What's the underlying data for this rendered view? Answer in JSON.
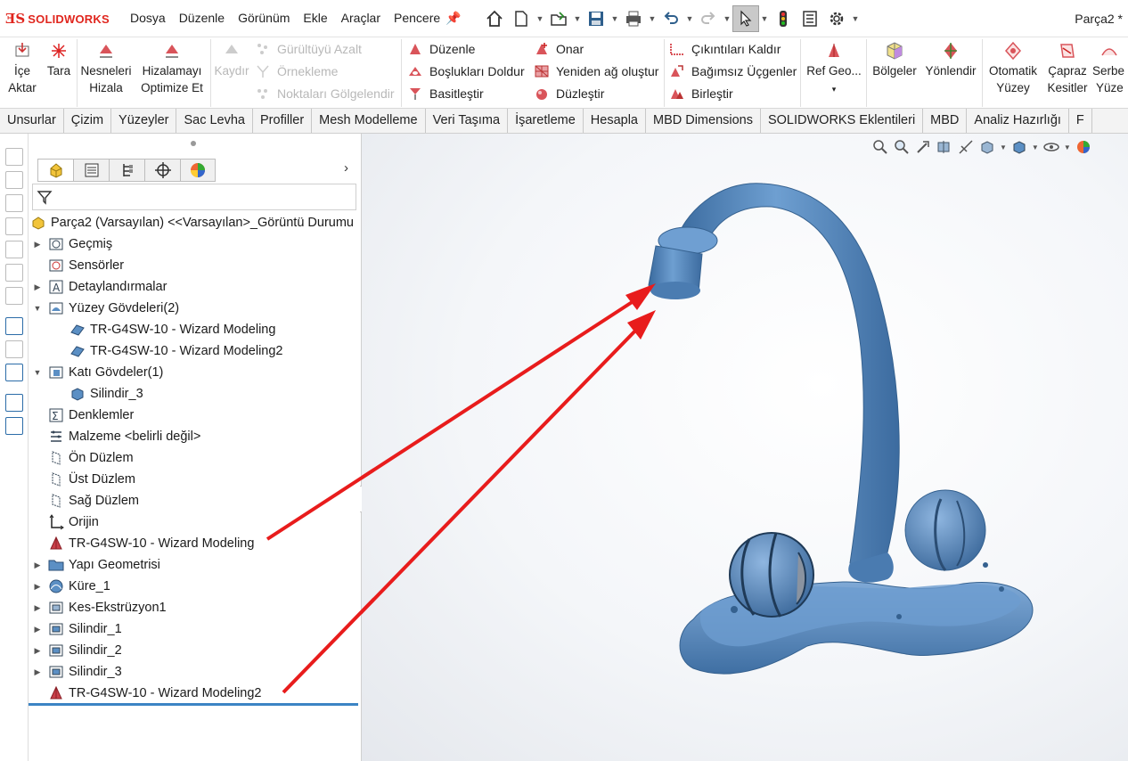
{
  "app": {
    "logo_text": "SOLIDWORKS",
    "doc_title": "Parça2 *"
  },
  "menu": [
    "Dosya",
    "Düzenle",
    "Görünüm",
    "Ekle",
    "Araçlar",
    "Pencere"
  ],
  "quick_access": [
    "home-icon",
    "new-document-icon",
    "open-icon",
    "save-icon",
    "print-icon",
    "undo-icon",
    "redo-icon",
    "select-icon",
    "rebuild-icon",
    "file-properties-icon",
    "options-icon"
  ],
  "ribbon": {
    "import": {
      "line1": "İçe",
      "line2": "Aktar"
    },
    "scan": {
      "line1": "Tara"
    },
    "align_objects": {
      "line1": "Nesneleri",
      "line2": "Hizala"
    },
    "optimize_align": {
      "line1": "Hizalamayı",
      "line2": "Optimize Et"
    },
    "scroll": {
      "line1": "Kaydır"
    },
    "reduce_noise": "Gürültüyü Azalt",
    "sample": "Örnekleme",
    "shade_points": "Noktaları Gölgelendir",
    "edit": "Düzenle",
    "fill_holes": "Boşlukları Doldur",
    "simplify": "Basitleştir",
    "repair": "Onar",
    "remesh": "Yeniden ağ oluştur",
    "smooth": "Düzleştir",
    "remove_features": "Çıkıntıları Kaldır",
    "detach_triangles": "Bağımsız Üçgenler",
    "merge": "Birleştir",
    "ref_geo": {
      "line1": "Ref Geo..."
    },
    "regions": {
      "line1": "Bölgeler"
    },
    "orient": {
      "line1": "Yönlendir"
    },
    "auto_surface": {
      "line1": "Otomatik",
      "line2": "Yüzey"
    },
    "cross_sections": {
      "line1": "Çapraz",
      "line2": "Kesitler"
    },
    "free_surface": {
      "line1": "Serbe",
      "line2": "Yüze"
    }
  },
  "tabs": [
    "Unsurlar",
    "Çizim",
    "Yüzeyler",
    "Sac Levha",
    "Profiller",
    "Mesh Modelleme",
    "Veri Taşıma",
    "İşaretleme",
    "Hesapla",
    "MBD Dimensions",
    "SOLIDWORKS Eklentileri",
    "MBD",
    "Analiz Hazırlığı",
    "F"
  ],
  "feature_tree": {
    "root": "Parça2 (Varsayılan) <<Varsayılan>_Görüntü Durumu",
    "items": [
      {
        "label": "Geçmiş",
        "icon": "history-icon",
        "expand": "collapsed",
        "level": 0
      },
      {
        "label": "Sensörler",
        "icon": "sensor-icon",
        "expand": "none",
        "level": 0
      },
      {
        "label": "Detaylandırmalar",
        "icon": "annotation-icon",
        "expand": "collapsed",
        "level": 0
      },
      {
        "label": "Yüzey Gövdeleri(2)",
        "icon": "surface-bodies-icon",
        "expand": "expanded",
        "level": 0
      },
      {
        "label": "TR-G4SW-10 - Wizard Modeling",
        "icon": "surface-body-icon",
        "expand": "none",
        "level": 1
      },
      {
        "label": "TR-G4SW-10 - Wizard Modeling2",
        "icon": "surface-body-icon",
        "expand": "none",
        "level": 1
      },
      {
        "label": "Katı Gövdeler(1)",
        "icon": "solid-bodies-icon",
        "expand": "expanded",
        "level": 0
      },
      {
        "label": "Silindir_3",
        "icon": "solid-body-icon",
        "expand": "none",
        "level": 1
      },
      {
        "label": "Denklemler",
        "icon": "equations-icon",
        "expand": "none",
        "level": 0
      },
      {
        "label": "Malzeme <belirli değil>",
        "icon": "material-icon",
        "expand": "none",
        "level": 0
      },
      {
        "label": "Ön Düzlem",
        "icon": "plane-icon",
        "expand": "none",
        "level": 0
      },
      {
        "label": "Üst Düzlem",
        "icon": "plane-icon",
        "expand": "none",
        "level": 0
      },
      {
        "label": "Sağ Düzlem",
        "icon": "plane-icon",
        "expand": "none",
        "level": 0
      },
      {
        "label": "Orijin",
        "icon": "origin-icon",
        "expand": "none",
        "level": 0
      },
      {
        "label": "TR-G4SW-10 - Wizard Modeling",
        "icon": "mesh-feature-icon",
        "expand": "none",
        "level": 0
      },
      {
        "label": "Yapı Geometrisi",
        "icon": "folder-icon",
        "expand": "collapsed",
        "level": 0
      },
      {
        "label": "Küre_1",
        "icon": "revolve-icon",
        "expand": "collapsed",
        "level": 0
      },
      {
        "label": "Kes-Ekstrüzyon1",
        "icon": "cut-extrude-icon",
        "expand": "collapsed",
        "level": 0
      },
      {
        "label": "Silindir_1",
        "icon": "extrude-icon",
        "expand": "collapsed",
        "level": 0
      },
      {
        "label": "Silindir_2",
        "icon": "extrude-icon",
        "expand": "collapsed",
        "level": 0
      },
      {
        "label": "Silindir_3",
        "icon": "extrude-icon",
        "expand": "collapsed",
        "level": 0
      },
      {
        "label": "TR-G4SW-10 - Wizard Modeling2",
        "icon": "mesh-feature-icon",
        "expand": "none",
        "level": 0
      }
    ]
  },
  "colors": {
    "accent": "#3c84c4",
    "model": "#4f86c0",
    "arrow": "#e81c1c",
    "brand": "#e0261e"
  }
}
